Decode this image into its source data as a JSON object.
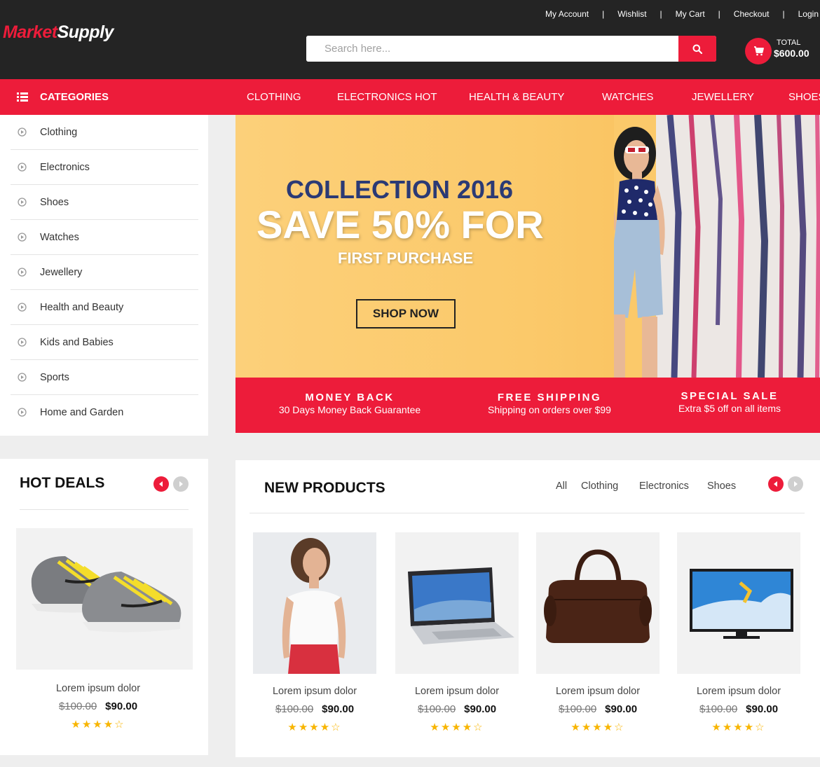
{
  "header": {
    "logo_part1": "Market",
    "logo_part2": "Supply",
    "links": [
      "My Account",
      "Wishlist",
      "My Cart",
      "Checkout",
      "Login"
    ],
    "separator": "|",
    "search_placeholder": "Search here...",
    "total_label": "TOTAL",
    "total_value": "$600.00",
    "icons": [
      "search-icon",
      "cart-icon"
    ]
  },
  "nav": {
    "categories_label": "CATEGORIES",
    "items": [
      "CLOTHING",
      "ELECTRONICS HOT",
      "HEALTH & BEAUTY",
      "WATCHES",
      "JEWELLERY",
      "SHOES"
    ]
  },
  "sidebar": {
    "items": [
      "Clothing",
      "Electronics",
      "Shoes",
      "Watches",
      "Jewellery",
      "Health and Beauty",
      "Kids and Babies",
      "Sports",
      "Home and Garden"
    ]
  },
  "banner": {
    "line1": "COLLECTION 2016",
    "line2": "SAVE 50% FOR",
    "line3": "FIRST PURCHASE",
    "button": "SHOP NOW"
  },
  "features": [
    {
      "title": "MONEY BACK",
      "subtitle": "30 Days Money Back Guarantee"
    },
    {
      "title": "FREE SHIPPING",
      "subtitle": "Shipping on orders over $99"
    },
    {
      "title": "SPECIAL SALE",
      "subtitle": "Extra $5 off on all items"
    }
  ],
  "hot_deals": {
    "title": "HOT DEALS",
    "product": {
      "name": "Lorem ipsum dolor",
      "old_price": "$100.00",
      "price": "$90.00",
      "rating": 4,
      "stars": "★★★★☆"
    }
  },
  "new_products": {
    "title": "NEW PRODUCTS",
    "tabs": [
      "All",
      "Clothing",
      "Electronics",
      "Shoes"
    ],
    "products": [
      {
        "name": "Lorem ipsum dolor",
        "old_price": "$100.00",
        "price": "$90.00",
        "rating": 4,
        "stars": "★★★★☆"
      },
      {
        "name": "Lorem ipsum dolor",
        "old_price": "$100.00",
        "price": "$90.00",
        "rating": 4,
        "stars": "★★★★☆"
      },
      {
        "name": "Lorem ipsum dolor",
        "old_price": "$100.00",
        "price": "$90.00",
        "rating": 4,
        "stars": "★★★★☆"
      },
      {
        "name": "Lorem ipsum dolor",
        "old_price": "$100.00",
        "price": "$90.00",
        "rating": 4,
        "stars": "★★★★☆"
      }
    ]
  },
  "colors": {
    "accent": "#ed1c3a",
    "header_bg": "#242424",
    "banner_bg": "#fbc96a",
    "star": "#f8b500"
  }
}
